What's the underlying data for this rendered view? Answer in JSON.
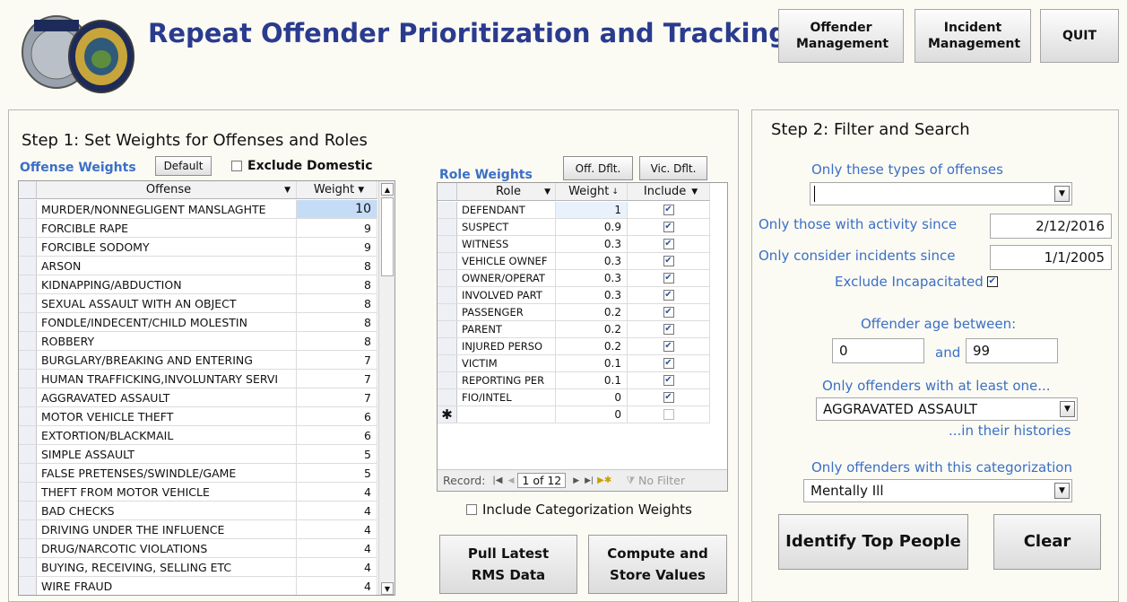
{
  "header": {
    "title": "Repeat Offender Prioritization and Tracking"
  },
  "nav_buttons": {
    "offender_mgmt": "Offender Management",
    "incident_mgmt": "Incident Management",
    "quit": "QUIT"
  },
  "step1": {
    "title": "Step 1: Set Weights for Offenses and Roles",
    "offense_label": "Offense Weights",
    "default_btn": "Default",
    "exclude_domestic": "Exclude Domestic",
    "offense_headers": {
      "offense": "Offense",
      "weight": "Weight"
    },
    "offenses": [
      {
        "name": "MURDER/NONNEGLIGENT MANSLAGHTE",
        "weight": "10"
      },
      {
        "name": "FORCIBLE RAPE",
        "weight": "9"
      },
      {
        "name": "FORCIBLE SODOMY",
        "weight": "9"
      },
      {
        "name": "ARSON",
        "weight": "8"
      },
      {
        "name": "KIDNAPPING/ABDUCTION",
        "weight": "8"
      },
      {
        "name": "SEXUAL ASSAULT WITH AN OBJECT",
        "weight": "8"
      },
      {
        "name": "FONDLE/INDECENT/CHILD MOLESTIN",
        "weight": "8"
      },
      {
        "name": "ROBBERY",
        "weight": "8"
      },
      {
        "name": "BURGLARY/BREAKING AND ENTERING",
        "weight": "7"
      },
      {
        "name": "HUMAN TRAFFICKING,INVOLUNTARY SERVI",
        "weight": "7"
      },
      {
        "name": "AGGRAVATED ASSAULT",
        "weight": "7"
      },
      {
        "name": "MOTOR VEHICLE THEFT",
        "weight": "6"
      },
      {
        "name": "EXTORTION/BLACKMAIL",
        "weight": "6"
      },
      {
        "name": "SIMPLE ASSAULT",
        "weight": "5"
      },
      {
        "name": "FALSE PRETENSES/SWINDLE/GAME",
        "weight": "5"
      },
      {
        "name": "THEFT FROM MOTOR VEHICLE",
        "weight": "4"
      },
      {
        "name": "BAD CHECKS",
        "weight": "4"
      },
      {
        "name": "DRIVING UNDER THE INFLUENCE",
        "weight": "4"
      },
      {
        "name": "DRUG/NARCOTIC VIOLATIONS",
        "weight": "4"
      },
      {
        "name": "BUYING, RECEIVING, SELLING ETC",
        "weight": "4"
      },
      {
        "name": "WIRE FRAUD",
        "weight": "4"
      }
    ],
    "role_label": "Role Weights",
    "off_dflt": "Off. Dflt.",
    "vic_dflt": "Vic. Dflt.",
    "role_headers": {
      "role": "Role",
      "weight": "Weight",
      "include": "Include"
    },
    "roles": [
      {
        "name": "DEFENDANT",
        "weight": "1",
        "include": true
      },
      {
        "name": "SUSPECT",
        "weight": "0.9",
        "include": true
      },
      {
        "name": "WITNESS",
        "weight": "0.3",
        "include": true
      },
      {
        "name": "VEHICLE OWNEF",
        "weight": "0.3",
        "include": true
      },
      {
        "name": "OWNER/OPERAT",
        "weight": "0.3",
        "include": true
      },
      {
        "name": "INVOLVED PART",
        "weight": "0.3",
        "include": true
      },
      {
        "name": "PASSENGER",
        "weight": "0.2",
        "include": true
      },
      {
        "name": "PARENT",
        "weight": "0.2",
        "include": true
      },
      {
        "name": "INJURED PERSO",
        "weight": "0.2",
        "include": true
      },
      {
        "name": "VICTIM",
        "weight": "0.1",
        "include": true
      },
      {
        "name": "REPORTING PER",
        "weight": "0.1",
        "include": true
      },
      {
        "name": "FIO/INTEL",
        "weight": "0",
        "include": true
      },
      {
        "name": "",
        "weight": "0",
        "include": false
      }
    ],
    "record_label": "Record:",
    "record_value": "1 of 12",
    "no_filter": "No Filter",
    "include_cat": "Include Categorization Weights",
    "pull_btn": "Pull Latest RMS Data",
    "compute_btn": "Compute and Store Values"
  },
  "step2": {
    "title": "Step 2: Filter and Search",
    "offense_types_label": "Only these types of offenses",
    "offense_types_value": "",
    "activity_label": "Only those with activity since",
    "activity_value": "2/12/2016",
    "incidents_label": "Only consider incidents since",
    "incidents_value": "1/1/2005",
    "exclude_incap": "Exclude Incapacitated",
    "age_label": "Offender age between:",
    "age_min": "0",
    "age_and": "and",
    "age_max": "99",
    "atleast_label": "Only offenders with at least one...",
    "atleast_value": "AGGRAVATED ASSAULT",
    "histories_label": "...in their histories",
    "categorization_label": "Only offenders with this categorization",
    "categorization_value": "Mentally Ill",
    "identify_btn": "Identify Top People",
    "clear_btn": "Clear"
  }
}
